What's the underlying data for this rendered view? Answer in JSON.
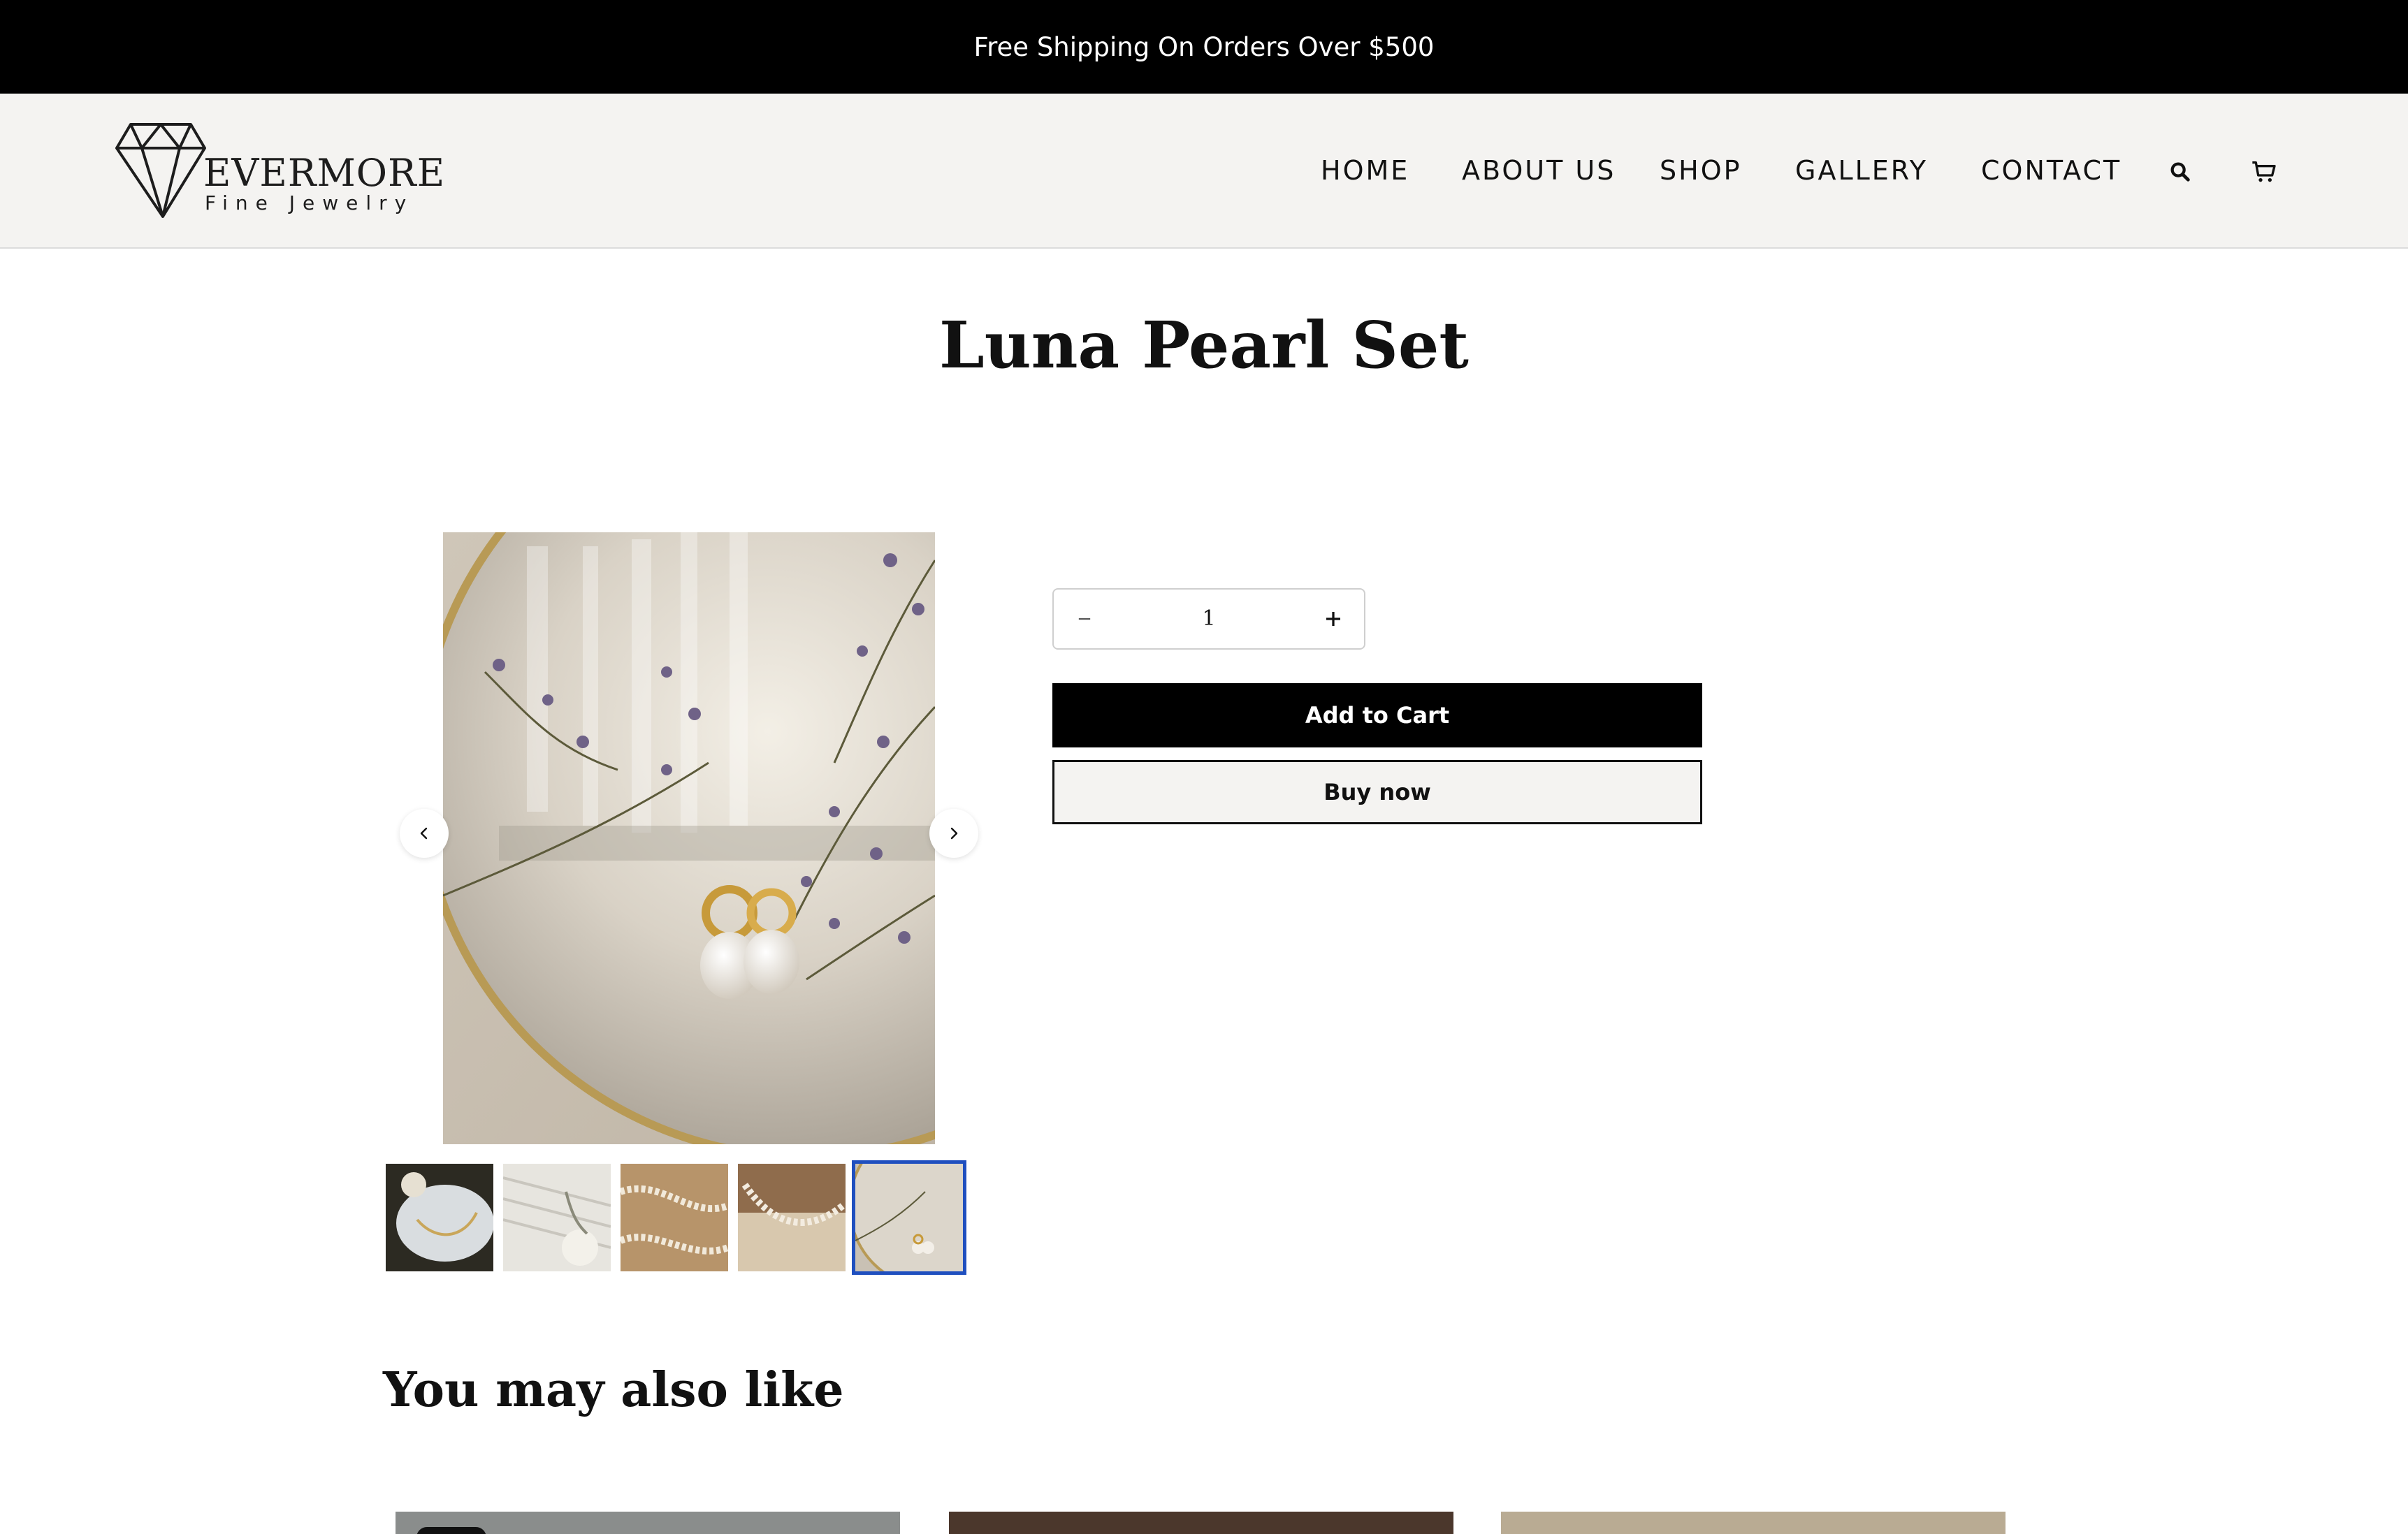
{
  "announcement": {
    "text": "Free Shipping On Orders Over $500"
  },
  "brand": {
    "name": "EVERMORE",
    "tagline": "Fine Jewelry"
  },
  "nav": {
    "items": [
      {
        "label": "HOME"
      },
      {
        "label": "ABOUT US"
      },
      {
        "label": "SHOP"
      },
      {
        "label": "GALLERY"
      },
      {
        "label": "CONTACT"
      }
    ],
    "icons": [
      "search-icon",
      "cart-icon"
    ]
  },
  "product": {
    "title": "Luna Pearl Set",
    "quantity": "1",
    "add_to_cart_label": "Add to Cart",
    "buy_now_label": "Buy now",
    "selected_thumbnail": 5,
    "thumbnail_count": 5
  },
  "recommendations": {
    "heading": "You may also like"
  },
  "colors": {
    "accent": "#000000",
    "header_bg": "#f4f3f1",
    "active_thumb": "#1f4fbf"
  }
}
